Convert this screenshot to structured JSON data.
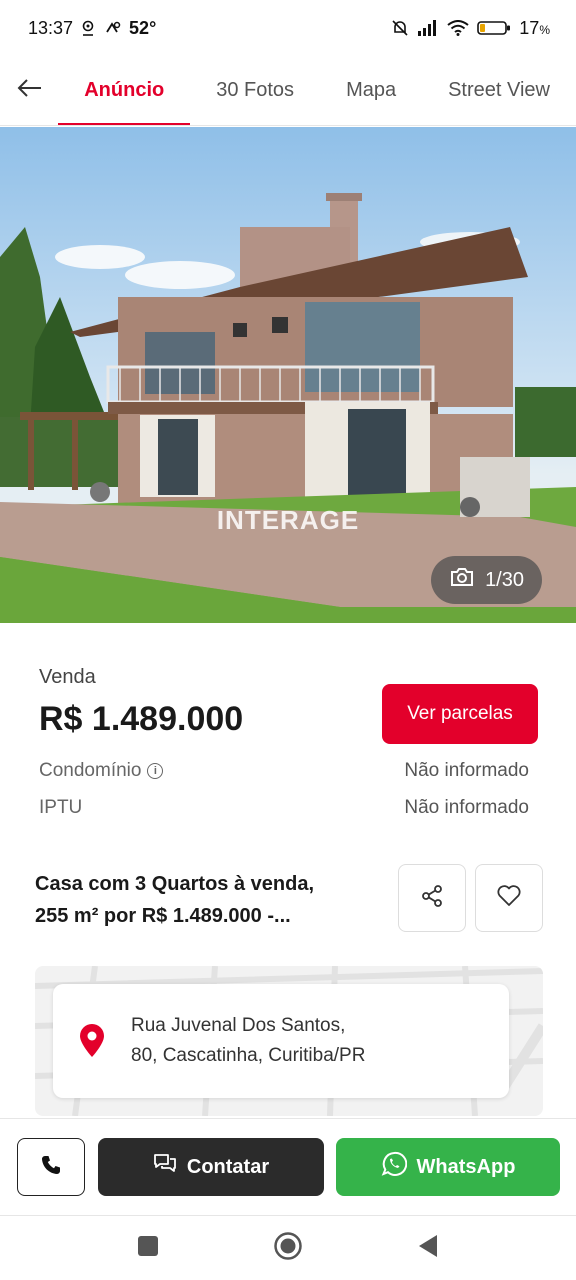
{
  "status_bar": {
    "time": "13:37",
    "temperature": "52°",
    "battery": "17",
    "battery_unit": "%",
    "icons": [
      "location-icon",
      "weather-icon",
      "mute-icon",
      "signal-icon",
      "wifi-icon",
      "battery-icon"
    ]
  },
  "tabs": [
    {
      "label": "Anúncio",
      "active": true
    },
    {
      "label": "30 Fotos",
      "active": false
    },
    {
      "label": "Mapa",
      "active": false
    },
    {
      "label": "Street View",
      "active": false
    }
  ],
  "photo": {
    "watermark": "INTERAGE",
    "counter": "1/30"
  },
  "listing": {
    "sale_label": "Venda",
    "price": "R$ 1.489.000",
    "installments_button": "Ver parcelas",
    "condo_label": "Condomínio",
    "condo_value": "Não informado",
    "iptu_label": "IPTU",
    "iptu_value": "Não informado",
    "title_line1": "Casa com 3 Quartos à venda,",
    "title_line2": "255 m² por R$ 1.489.000 -..."
  },
  "address": {
    "line1": "Rua Juvenal Dos Santos,",
    "line2": "80, Cascatinha, Curitiba/PR"
  },
  "actions": {
    "contact_label": "Contatar",
    "whatsapp_label": "WhatsApp"
  },
  "colors": {
    "accent": "#e3002b",
    "whatsapp": "#35b34a",
    "dark_button": "#2b2b2b"
  }
}
